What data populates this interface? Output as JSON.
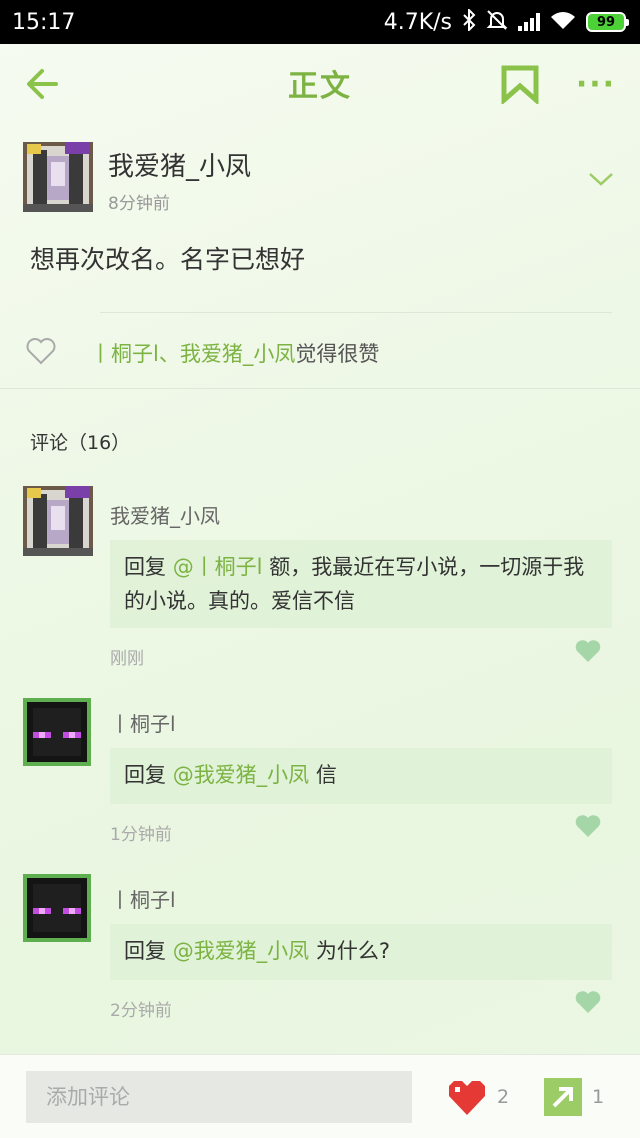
{
  "status_bar": {
    "time": "15:17",
    "network_speed": "4.7K/s",
    "battery": "99",
    "bluetooth_icon": "bluetooth-icon",
    "mute_icon": "bell-off-icon",
    "wifi_icon": "wifi-icon"
  },
  "header": {
    "title": "正文",
    "more_label": "···"
  },
  "post": {
    "author": "我爱猪_小凤",
    "time": "8分钟前",
    "content": "想再次改名。名字已想好",
    "likers_names": "丨桐子l、我爱猪_小凤",
    "likers_suffix": "觉得很赞"
  },
  "comments_section": {
    "header": "评论（16）",
    "items": [
      {
        "author": "我爱猪_小凤",
        "reply_prefix": "回复",
        "mention": "@丨桐子l",
        "text": " 额，我最近在写小说，一切源于我的小说。真的。爱信不信",
        "time": "刚刚"
      },
      {
        "author": "丨桐子l",
        "reply_prefix": "回复",
        "mention": "@我爱猪_小凤",
        "text": " 信",
        "time": "1分钟前"
      },
      {
        "author": "丨桐子l",
        "reply_prefix": "回复",
        "mention": "@我爱猪_小凤",
        "text": " 为什么?",
        "time": "2分钟前"
      }
    ]
  },
  "bottom_bar": {
    "input_placeholder": "添加评论",
    "like_count": "2",
    "share_count": "1"
  },
  "colors": {
    "accent": "#7cb342",
    "heart_red": "#e53935",
    "share_green": "#9ccc65"
  }
}
